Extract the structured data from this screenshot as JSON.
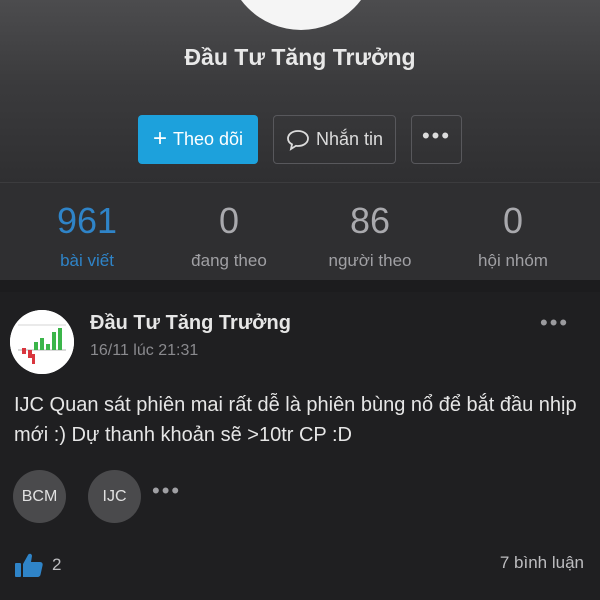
{
  "profile": {
    "name": "Đầu Tư Tăng Trưởng",
    "follow_button": {
      "icon": "+",
      "label": "Theo dõi"
    },
    "message_button": {
      "label": "Nhắn tin"
    },
    "more_button": {
      "label": "•••"
    }
  },
  "stats": [
    {
      "value": "961",
      "label": "bài viết",
      "active": true
    },
    {
      "value": "0",
      "label": "đang theo"
    },
    {
      "value": "86",
      "label": "người theo"
    },
    {
      "value": "0",
      "label": "hội nhóm"
    }
  ],
  "post": {
    "author": "Đầu Tư Tăng Trưởng",
    "time": "16/11 lúc 21:31",
    "menu": "•••",
    "body": "IJC Quan sát phiên mai rất dễ là phiên bùng nổ để bắt đầu nhịp mới :) Dự thanh khoản sẽ >10tr CP :D",
    "tags": [
      "BCM",
      "IJC"
    ],
    "tags_more": "•••",
    "likes": "2",
    "comments": "7 bình luận"
  },
  "colors": {
    "accent": "#1da1dc",
    "active_stat": "#2f84c8",
    "background": "#1c1c1e"
  },
  "icons": [
    "plus-icon",
    "chat-bubble-icon",
    "more-dots-icon",
    "thumbs-up-icon"
  ]
}
